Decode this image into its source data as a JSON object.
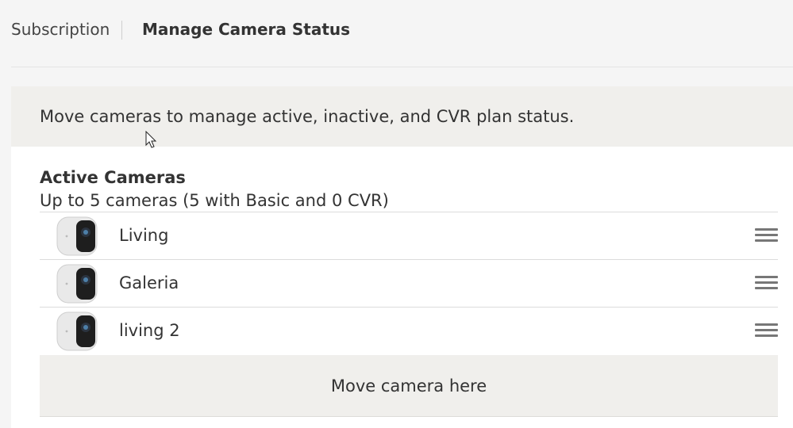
{
  "nav": {
    "subscription_label": "Subscription",
    "current_label": "Manage Camera Status"
  },
  "banner": {
    "text": "Move cameras to manage active, inactive, and CVR plan status."
  },
  "active_section": {
    "title": "Active Cameras",
    "subtitle": "Up to 5 cameras (5 with Basic and 0 CVR)",
    "cameras": [
      {
        "name": "Living"
      },
      {
        "name": "Galeria"
      },
      {
        "name": "living 2"
      }
    ],
    "drop_label": "Move camera here"
  },
  "icons": {
    "camera_thumbnail": "camera-thumbnail-icon",
    "drag_handle": "drag-handle-icon",
    "cursor": "mouse-cursor-icon"
  },
  "colors": {
    "banner_bg": "#f0efec",
    "panel_bg": "#ffffff",
    "page_bg": "#f5f5f5"
  }
}
